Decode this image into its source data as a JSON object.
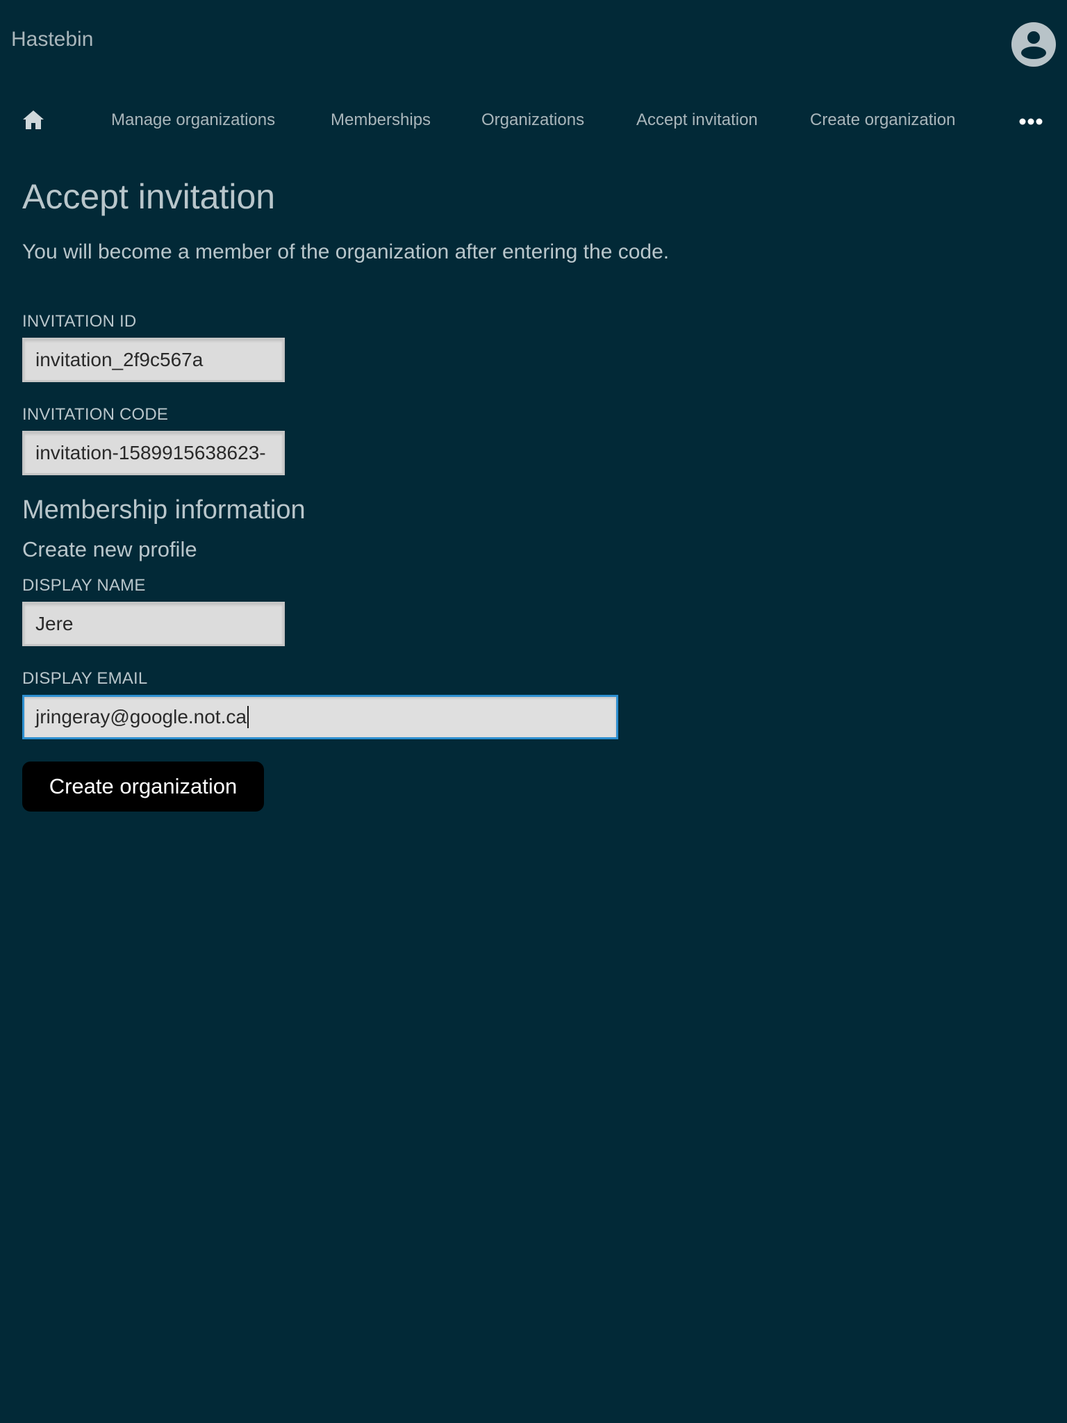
{
  "header": {
    "app_title": "Hastebin",
    "avatar_icon": "user-avatar-icon"
  },
  "nav": {
    "home_icon": "home-icon",
    "items": [
      {
        "label": "Manage organizations"
      },
      {
        "label": "Memberships"
      },
      {
        "label": "Organizations"
      },
      {
        "label": "Accept invitation"
      },
      {
        "label": "Create organization"
      }
    ],
    "more_icon": "more-horizontal-icon"
  },
  "main": {
    "title": "Accept invitation",
    "subtitle": "You will become a member of the organization after entering the code.",
    "fields": {
      "invitation_id": {
        "label": "INVITATION ID",
        "value": "invitation_2f9c567a"
      },
      "invitation_code": {
        "label": "INVITATION CODE",
        "value": "invitation-1589915638623-"
      },
      "display_name": {
        "label": "DISPLAY NAME",
        "value": "Jere"
      },
      "display_email": {
        "label": "DISPLAY EMAIL",
        "value": "jringeray@google.not.ca"
      }
    },
    "membership_section_title": "Membership information",
    "membership_section_subtitle": "Create new profile",
    "submit_label": "Create organization"
  },
  "colors": {
    "background": "#022937",
    "text": "#b9c6cb",
    "input_background": "#dcdcdc",
    "focus_border": "#2d8fd0",
    "button_background": "#000000",
    "button_text": "#ffffff"
  }
}
